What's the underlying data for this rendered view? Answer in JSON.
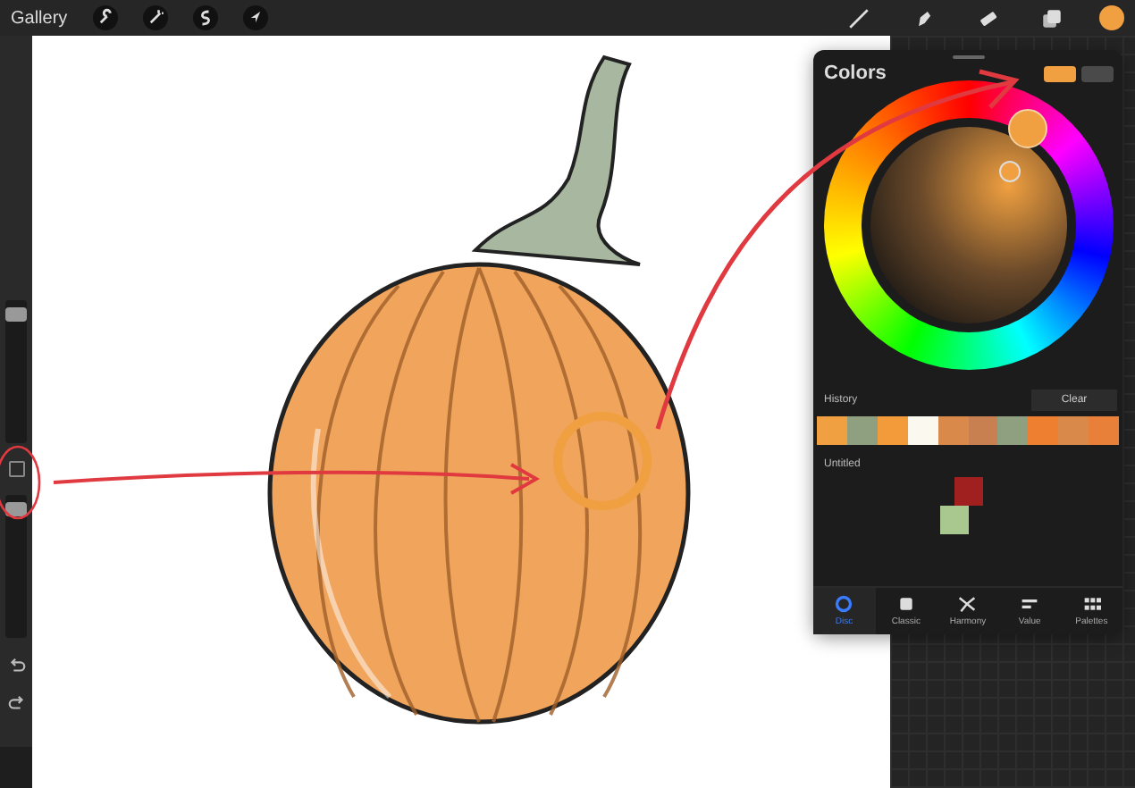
{
  "top_bar": {
    "gallery": "Gallery",
    "current_color": {
      "color": "#f0a040"
    }
  },
  "sidebar": {
    "sliders": [
      {
        "level": 0.95
      },
      {
        "level": 0.95
      }
    ]
  },
  "colors_panel": {
    "title": "Colors",
    "current_swatches": [
      {
        "color": "#f0a040"
      },
      {
        "color": "#4a4a4a"
      }
    ],
    "history_label": "History",
    "clear_button": "Clear",
    "history": [
      {
        "color": "#f0a040"
      },
      {
        "color": "#8fa080"
      },
      {
        "color": "#f39a3a"
      },
      {
        "color": "#fbf8f0"
      },
      {
        "color": "#d98a4a"
      },
      {
        "color": "#c98050"
      },
      {
        "color": "#8fa080"
      },
      {
        "color": "#ee7f30"
      },
      {
        "color": "#d98a4a"
      },
      {
        "color": "#e8803a"
      }
    ],
    "palette_name": "Untitled",
    "palette": [
      {
        "color": "#a02020"
      },
      {
        "color": "#a8c890"
      }
    ],
    "tabs": [
      {
        "label": "Disc",
        "kind": "disc",
        "selected": true
      },
      {
        "label": "Classic",
        "kind": "classic",
        "selected": false
      },
      {
        "label": "Harmony",
        "kind": "harmony",
        "selected": false
      },
      {
        "label": "Value",
        "kind": "value",
        "selected": false
      },
      {
        "label": "Palettes",
        "kind": "palettes",
        "selected": false
      }
    ]
  }
}
